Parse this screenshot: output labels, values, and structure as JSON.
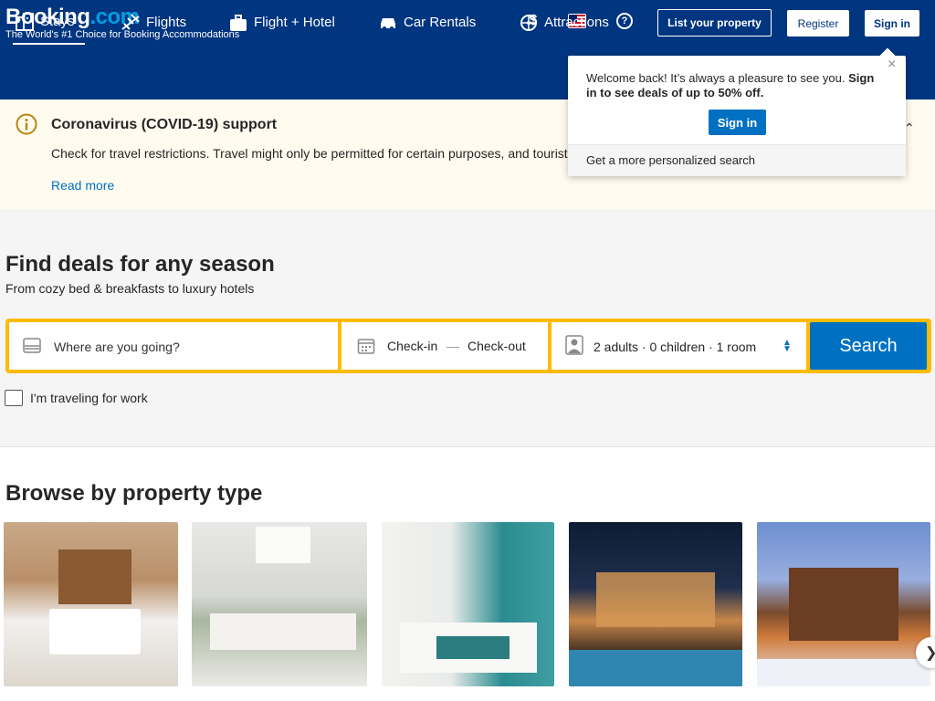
{
  "header": {
    "logo_text": "Booking",
    "logo_suffix": ".com",
    "tagline": "The World's #1 Choice for Booking Accommodations",
    "currency": "$",
    "help": "?",
    "list_property": "List your property",
    "register": "Register",
    "sign_in": "Sign in"
  },
  "nav": {
    "items": [
      {
        "label": "Stays",
        "icon": "bed-icon"
      },
      {
        "label": "Flights",
        "icon": "plane-icon"
      },
      {
        "label": "Flight + Hotel",
        "icon": "suitcase-icon"
      },
      {
        "label": "Car Rentals",
        "icon": "car-icon"
      },
      {
        "label": "Attractions",
        "icon": "ferris-wheel-icon"
      }
    ]
  },
  "covid": {
    "title": "Coronavirus (COVID-19) support",
    "text": "Check for travel restrictions. Travel might only be permitted for certain purposes, and tourist travel in particular may not be allowed.",
    "link": "Read more"
  },
  "popup": {
    "message_plain": "Welcome back! It’s always a pleasure to see you. ",
    "message_bold": "Sign in to see deals of up to 50% off.",
    "sign_in": "Sign in",
    "footer": "Get a more personalized search",
    "close": "×"
  },
  "main": {
    "title": "Find deals for any season",
    "subtitle": "From cozy bed & breakfasts to luxury hotels"
  },
  "search": {
    "destination_placeholder": "Where are you going?",
    "check_in": "Check-in",
    "dash": "—",
    "check_out": "Check-out",
    "guests": "2 adults  ·  0 children  ·  1 room",
    "button": "Search",
    "work_label": "I'm traveling for work"
  },
  "browse": {
    "title": "Browse by property type"
  },
  "colors": {
    "brand_blue": "#003580",
    "accent_blue": "#0071c2",
    "search_yellow": "#febb02"
  }
}
